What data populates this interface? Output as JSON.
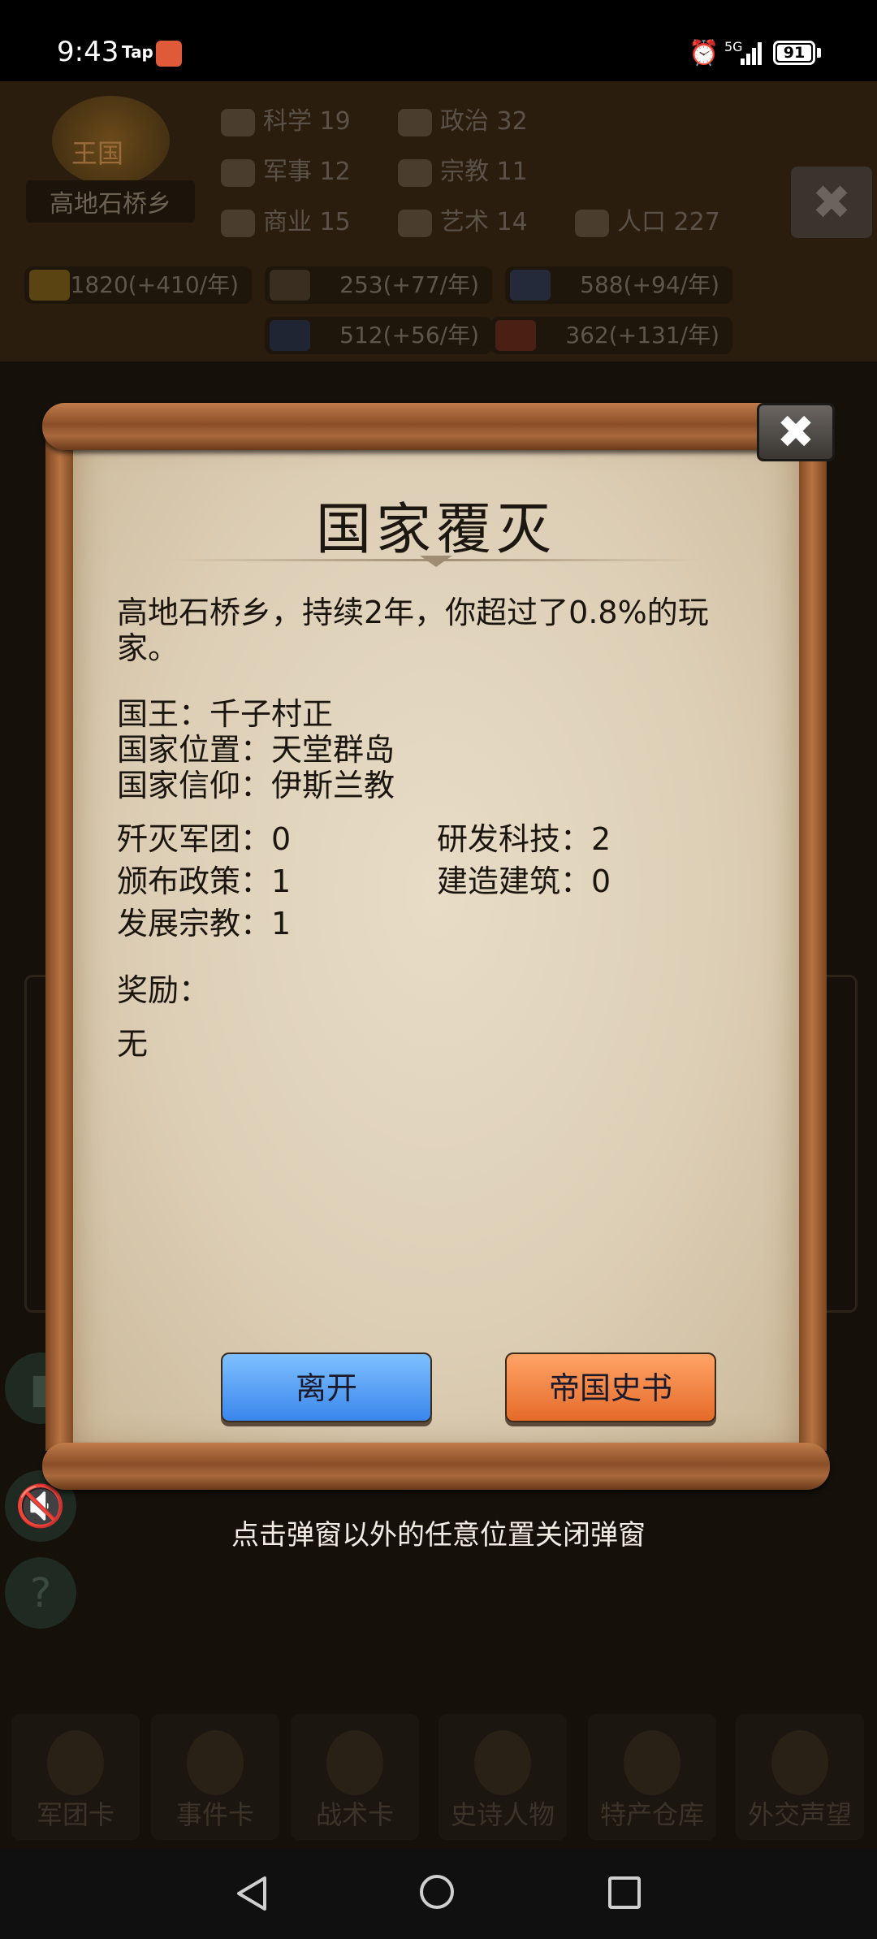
{
  "status_bar": {
    "time": "9:43",
    "app_label": "Tap",
    "network": "5G",
    "battery": "91"
  },
  "game_header": {
    "kingdom_badge": "王国",
    "kingdom_name": "高地石桥乡",
    "stats": [
      {
        "name": "科学",
        "value": "19"
      },
      {
        "name": "政治",
        "value": "32"
      },
      {
        "name": "军事",
        "value": "12"
      },
      {
        "name": "宗教",
        "value": "11"
      },
      {
        "name": "商业",
        "value": "15"
      },
      {
        "name": "艺术",
        "value": "14"
      },
      {
        "name": "人口",
        "value": "227"
      }
    ],
    "resources": [
      "1820(+410/年)",
      "253(+77/年)",
      "588(+94/年)",
      "512(+56/年)",
      "362(+131/年)"
    ]
  },
  "popup": {
    "title": "国家覆灭",
    "summary": "高地石桥乡，持续2年，你超过了0.8%的玩家。",
    "info": {
      "king": "国王：千子村正",
      "location": "国家位置：天堂群岛",
      "religion": "国家信仰：伊斯兰教"
    },
    "stats": {
      "armies_destroyed": "歼灭军团：0",
      "tech_researched": "研发科技：2",
      "policies_issued": "颁布政策：1",
      "buildings_built": "建造建筑：0",
      "religion_developed": "发展宗教：1"
    },
    "reward_label": "奖励：",
    "reward_value": "无",
    "buttons": {
      "leave": "离开",
      "history": "帝国史书"
    },
    "close_icon": "close-icon"
  },
  "dismiss_hint": "点击弹窗以外的任意位置关闭弹窗",
  "bottom_nav": [
    "军团卡",
    "事件卡",
    "战术卡",
    "史诗人物",
    "特产仓库",
    "外交声望"
  ]
}
